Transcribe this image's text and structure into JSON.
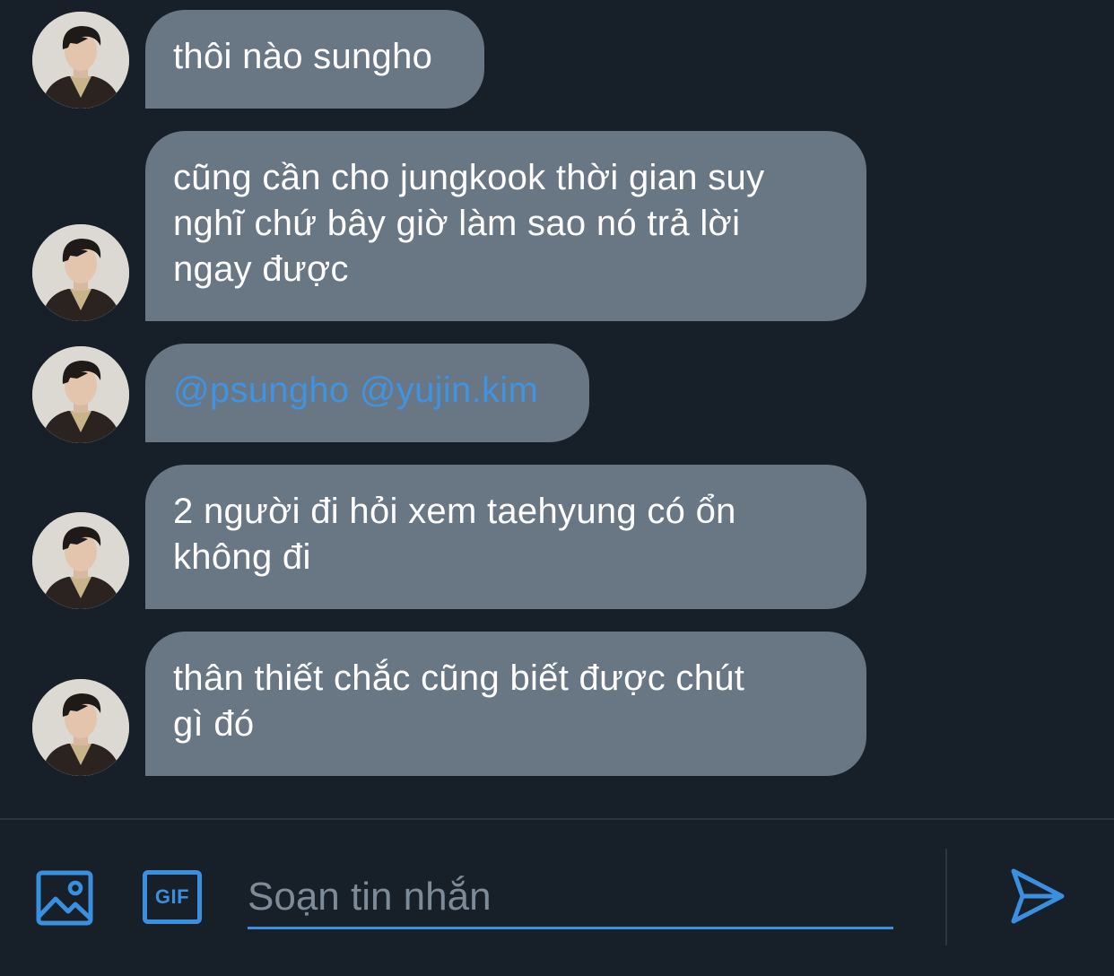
{
  "colors": {
    "background": "#172029",
    "bubble": "#697684",
    "accent": "#3a8fe0",
    "mention": "#3f93e0",
    "placeholder": "#7d8a98"
  },
  "messages": [
    {
      "sender_avatar": "user-avatar-photo",
      "lines": [
        "thôi nào sungho"
      ]
    },
    {
      "sender_avatar": "user-avatar-photo",
      "lines": [
        "cũng cần cho jungkook thời gian suy",
        "nghĩ chứ bây giờ làm sao nó trả lời",
        "ngay được"
      ]
    },
    {
      "sender_avatar": "user-avatar-photo",
      "mentions": [
        "@psungho",
        "@yujin.kim"
      ]
    },
    {
      "sender_avatar": "user-avatar-photo",
      "lines": [
        "2 người đi hỏi xem taehyung có ổn",
        "không đi"
      ]
    },
    {
      "sender_avatar": "user-avatar-photo",
      "lines": [
        "thân thiết chắc cũng biết được chút",
        "gì đó"
      ]
    }
  ],
  "composer": {
    "image_icon": "image-icon",
    "gif_icon": "gif-icon",
    "gif_label": "GIF",
    "placeholder": "Soạn tin nhắn",
    "send_icon": "send-icon"
  }
}
